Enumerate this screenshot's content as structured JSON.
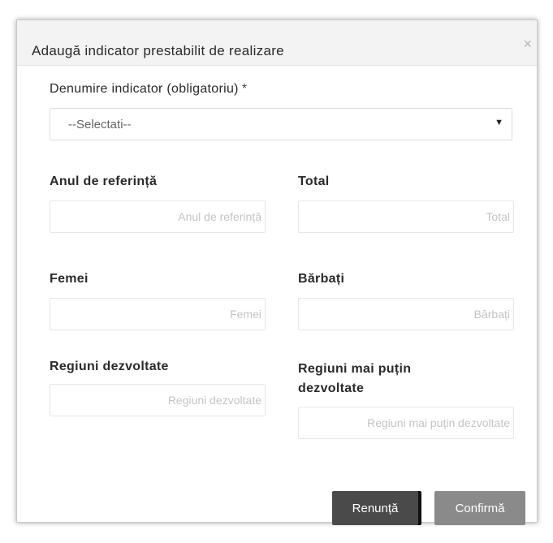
{
  "dialog": {
    "title": "Adaugă indicator prestabilit de realizare",
    "close_symbol": "×"
  },
  "indicator": {
    "label": "Denumire indicator (obligatoriu)",
    "required_mark": "*",
    "selected_value": "--Selectati--",
    "arrow_icon": "caret-down-icon"
  },
  "fields": {
    "anul": {
      "label": "Anul de referință",
      "placeholder": "Anul de referință",
      "value": ""
    },
    "total": {
      "label": "Total",
      "placeholder": "Total",
      "value": ""
    },
    "femei": {
      "label": "Femei",
      "placeholder": "Femei",
      "value": ""
    },
    "barbati": {
      "label": "Bărbați",
      "placeholder": "Bărbați",
      "value": ""
    },
    "regiuni_dezvoltate": {
      "label": "Regiuni dezvoltate",
      "placeholder": "Regiuni dezvoltate",
      "value": ""
    },
    "regiuni_mai_putin_line1": "Regiuni mai puțin",
    "regiuni_mai_putin_line2": "dezvoltate",
    "regiuni_mai_putin_placeholder": "Regiuni mai puțin dezvoltate"
  },
  "buttons": {
    "cancel": "Renunță",
    "confirm": "Confirmă"
  },
  "colors": {
    "cancel_bg": "#4a4a4a",
    "confirm_bg": "#8a8a8a",
    "header_bg": "#f3f3f3"
  }
}
